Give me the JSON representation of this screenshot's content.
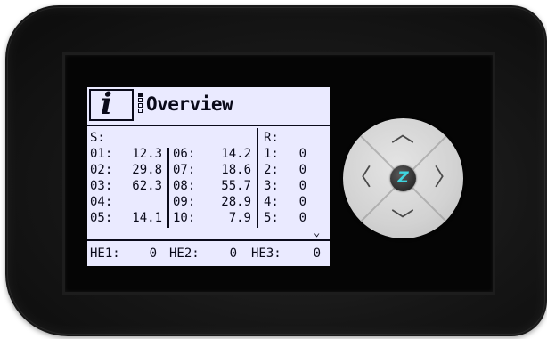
{
  "screen": {
    "info_icon": "i",
    "title": "Overview"
  },
  "sensors": {
    "header": "S:",
    "col1": [
      {
        "label": "01:",
        "value": "12.3"
      },
      {
        "label": "02:",
        "value": "29.8"
      },
      {
        "label": "03:",
        "value": "62.3"
      },
      {
        "label": "04:",
        "value": ""
      },
      {
        "label": "05:",
        "value": "14.1"
      }
    ],
    "col2": [
      {
        "label": "06:",
        "value": "14.2"
      },
      {
        "label": "07:",
        "value": "18.6"
      },
      {
        "label": "08:",
        "value": "55.7"
      },
      {
        "label": "09:",
        "value": "28.9"
      },
      {
        "label": "10:",
        "value": "7.9"
      }
    ]
  },
  "relays": {
    "header": "R:",
    "items": [
      {
        "label": "1:",
        "value": "0"
      },
      {
        "label": "2:",
        "value": "0"
      },
      {
        "label": "3:",
        "value": "0"
      },
      {
        "label": "4:",
        "value": "0"
      },
      {
        "label": "5:",
        "value": "0"
      }
    ],
    "more_glyph": "⌄"
  },
  "heat_exchangers": [
    {
      "label": "HE1:",
      "value": "0"
    },
    {
      "label": "HE2:",
      "value": "0"
    },
    {
      "label": "HE3:",
      "value": "0"
    }
  ],
  "dpad": {
    "up": "︿",
    "down": "﹀",
    "left": "〈",
    "right": "〉",
    "center": "Z",
    "center_color": "#3fd6e0"
  },
  "icons": {
    "info": "info-icon",
    "up": "chevron-up-icon",
    "down": "chevron-down-icon",
    "left": "chevron-left-icon",
    "right": "chevron-right-icon",
    "center": "logo-z-icon"
  },
  "colors": {
    "lcd_background": "#eaeaff",
    "lcd_text": "#0a0a1a",
    "bezel": "#161616"
  }
}
